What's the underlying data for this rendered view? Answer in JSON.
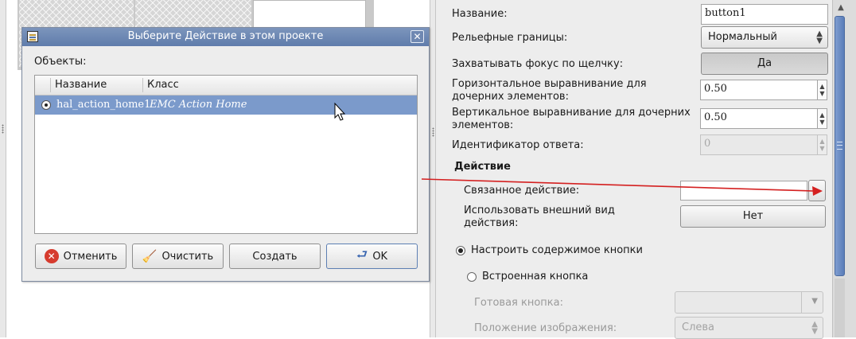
{
  "dialog": {
    "title": "Выберите Действие в этом проекте",
    "close_glyph": "✕",
    "objects_label": "Объекты:",
    "columns": [
      "Название",
      "Класс"
    ],
    "rows": [
      {
        "name": "hal_action_home1",
        "class": "EMC Action Home"
      }
    ],
    "buttons": {
      "cancel": "Отменить",
      "clear": "Очистить",
      "create": "Создать",
      "ok": "OK"
    }
  },
  "properties": {
    "name_label": "Название:",
    "name_value": "button1",
    "relief_label": "Рельефные границы:",
    "relief_value": "Нормальный",
    "focus_label": "Захватывать фокус по щелчку:",
    "focus_value": "Да",
    "halign_label": "Горизонтальное выравнивание для дочерних элементов:",
    "halign_value": "0.50",
    "valign_label": "Вертикальное выравнивание для дочерних элементов:",
    "valign_value": "0.50",
    "response_label": "Идентификатор ответа:",
    "response_value": "0",
    "action_section": "Действие",
    "related_action_label": "Связанное действие:",
    "related_action_value": "",
    "related_action_btn": "...",
    "use_appearance_label": "Использовать внешний вид действия:",
    "use_appearance_value": "Нет",
    "radio_custom": "Настроить содержимое кнопки",
    "radio_builtin": "Встроенная кнопка",
    "stock_button_label": "Готовая кнопка:",
    "stock_button_value": "",
    "image_position_label": "Положение изображения:",
    "image_position_value": "Слева"
  },
  "colors": {
    "selection": "#7b9acb",
    "titlebar": "#6a85b3",
    "annotation_arrow": "#d42020",
    "cancel_icon": "#d63b2e"
  },
  "icons": {
    "title": "dialog-list-icon",
    "cancel": "cancel-circle-icon",
    "clear": "broom-icon",
    "ok": "ok-arrow-icon"
  }
}
